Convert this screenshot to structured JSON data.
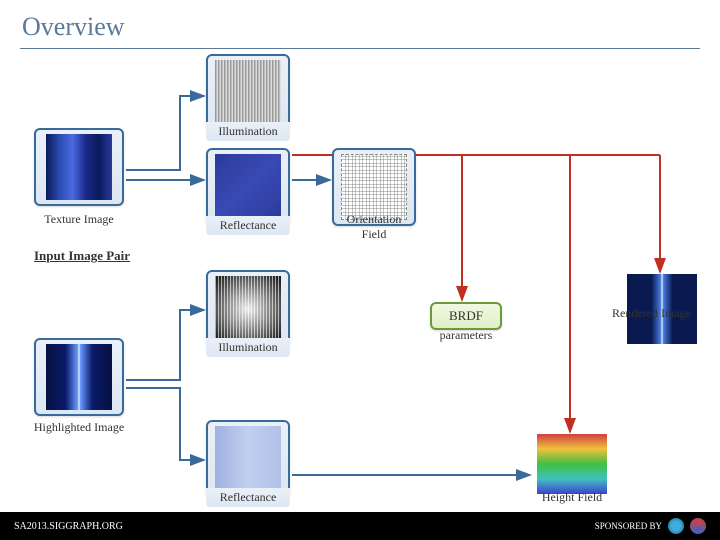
{
  "title": "Overview",
  "nodes": {
    "texture_image": "Texture Image",
    "illumination_top": "Illumination",
    "reflectance_top": "Reflectance",
    "orientation_field": "Orientation\nField",
    "input_image_pair": "Input Image Pair",
    "brdf": "BRDF",
    "brdf_sub": "parameters",
    "rendered_image": "Rendered Image",
    "illumination_bottom": "Illumination",
    "highlighted_image": "Highlighted Image",
    "reflectance_bottom": "Reflectance",
    "height_field": "Height Field"
  },
  "footer": {
    "left": "SA2013.SIGGRAPH.ORG",
    "right": "SPONSORED BY"
  }
}
